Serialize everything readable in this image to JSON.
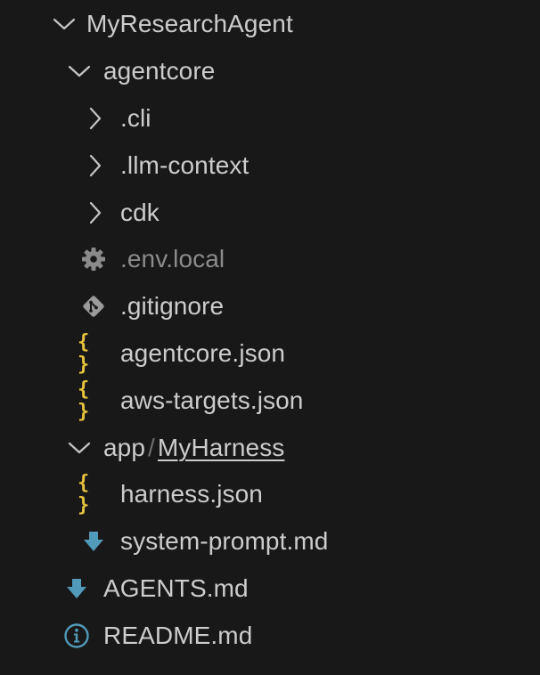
{
  "explorer": {
    "root": {
      "label": "MyResearchAgent",
      "icon": "chevron-down-icon"
    },
    "agentcore": {
      "label": "agentcore",
      "icon": "chevron-down-icon",
      "children": [
        {
          "label": ".cli",
          "icon": "chevron-right-icon"
        },
        {
          "label": ".llm-context",
          "icon": "chevron-right-icon"
        },
        {
          "label": "cdk",
          "icon": "chevron-right-icon"
        },
        {
          "label": ".env.local",
          "icon": "gear-icon"
        },
        {
          "label": ".gitignore",
          "icon": "git-icon"
        },
        {
          "label": "agentcore.json",
          "icon": "json-braces-icon"
        },
        {
          "label": "aws-targets.json",
          "icon": "json-braces-icon"
        }
      ]
    },
    "app": {
      "parent_label": "app",
      "separator": "/",
      "child_label": "MyHarness",
      "icon": "chevron-down-icon",
      "children": [
        {
          "label": "harness.json",
          "icon": "json-braces-icon"
        },
        {
          "label": "system-prompt.md",
          "icon": "markdown-down-arrow-icon"
        }
      ]
    },
    "files": [
      {
        "label": "AGENTS.md",
        "icon": "markdown-down-arrow-icon"
      },
      {
        "label": "README.md",
        "icon": "info-icon"
      }
    ],
    "json_glyph": "{ }",
    "colors": {
      "background": "#181818",
      "text": "#cccccc",
      "dim_text": "#8b8b8b",
      "json_icon": "#e5c33d",
      "markdown_icon": "#519aba",
      "git_icon": "#a0a0a0"
    }
  }
}
